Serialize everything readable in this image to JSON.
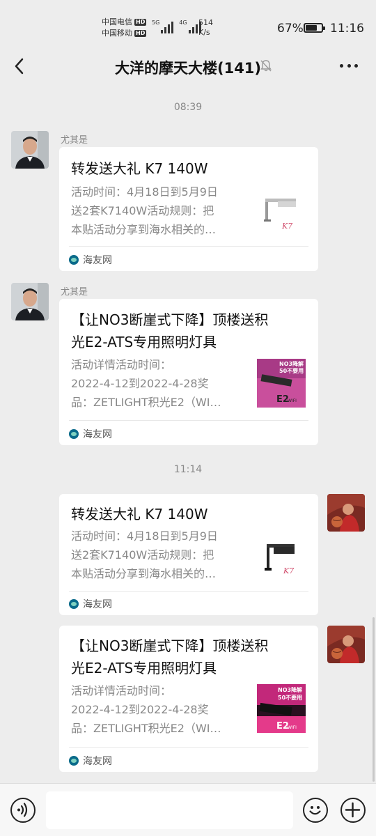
{
  "status_bar": {
    "carrier_1": "中国电信",
    "carrier_2": "中国移动",
    "hd": "HD",
    "signal_1": "5G",
    "signal_2": "4G",
    "speed_value": "514",
    "speed_unit": "K/s",
    "battery": "67%",
    "battery_level": 0.67,
    "time": "11:16"
  },
  "nav": {
    "title": "大洋的摩天大楼(141)",
    "back_icon": "chevron-left-icon",
    "mute_icon": "bell-off-icon",
    "more_icon": "more-dots-icon"
  },
  "chat": {
    "messages": [
      {
        "type": "timestamp",
        "text": "08:39"
      },
      {
        "type": "card",
        "side": "left",
        "sender": "尤其是",
        "title": "转发送大礼 K7 140W",
        "desc": [
          "活动时间：4月18日到5月9日",
          "送2套K7140W活动规则：把",
          "本贴活动分享到海水相关的…"
        ],
        "source": "海友网"
      },
      {
        "type": "card",
        "side": "left",
        "sender": "尤其是",
        "title": [
          "【让NO3断崖式下降】顶楼送积",
          "光E2-ATS专用照明灯具"
        ],
        "desc": [
          "活动详情活动时间：",
          "2022-4-12到2022-4-28奖",
          "品：ZETLIGHT积光E2（WI…"
        ],
        "source": "海友网"
      },
      {
        "type": "timestamp",
        "text": "11:14"
      },
      {
        "type": "card",
        "side": "right",
        "title": "转发送大礼 K7 140W",
        "desc": [
          "活动时间：4月18日到5月9日",
          "送2套K7140W活动规则：把",
          "本贴活动分享到海水相关的…"
        ],
        "source": "海友网"
      },
      {
        "type": "card",
        "side": "right",
        "title": [
          "【让NO3断崖式下降】顶楼送积",
          "光E2-ATS专用照明灯具"
        ],
        "desc": [
          "活动详情活动时间：",
          "2022-4-12到2022-4-28奖",
          "品：ZETLIGHT积光E2（WI…"
        ],
        "source": "海友网"
      }
    ]
  },
  "thumb_text": {
    "k7": "K7",
    "e2_banner_1": "NO3降解",
    "e2_banner_2": "50不要用",
    "e2_label": "E2",
    "e2_wifi": "WIFI"
  },
  "input_bar": {
    "voice_icon": "voice-icon",
    "emoji_icon": "emoji-icon",
    "add_icon": "plus-icon",
    "text_value": ""
  },
  "colors": {
    "background": "#ededed",
    "card": "#ffffff",
    "muted_text": "#888888",
    "source_icon": "#0a6a8a"
  }
}
